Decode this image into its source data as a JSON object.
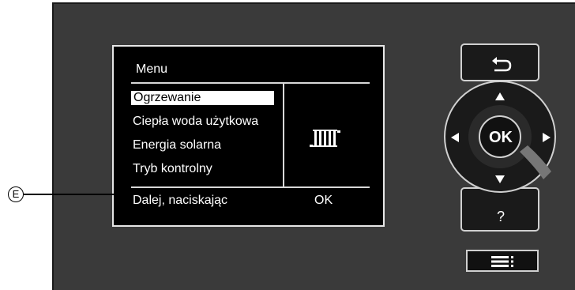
{
  "screen": {
    "title": "Menu",
    "items": [
      {
        "label": "Ogrzewanie",
        "selected": true
      },
      {
        "label": "Ciepła woda użytkowa",
        "selected": false
      },
      {
        "label": "Energia solarna",
        "selected": false
      },
      {
        "label": "Tryb kontrolny",
        "selected": false
      }
    ],
    "footer_text": "Dalej, naciskając",
    "footer_key": "OK",
    "preview_icon": "radiator-icon"
  },
  "callout": {
    "label": "E"
  },
  "controls": {
    "back_icon": "back-arrow-icon",
    "ok_label": "OK",
    "help_label": "?",
    "menu_icon": "menu-list-icon",
    "up_icon": "up-arrow-icon",
    "down_icon": "down-arrow-icon",
    "left_icon": "left-arrow-icon",
    "right_icon": "right-arrow-icon"
  },
  "colors": {
    "panel": "#3a3a3a",
    "screen": "#000000",
    "text": "#ffffff"
  }
}
